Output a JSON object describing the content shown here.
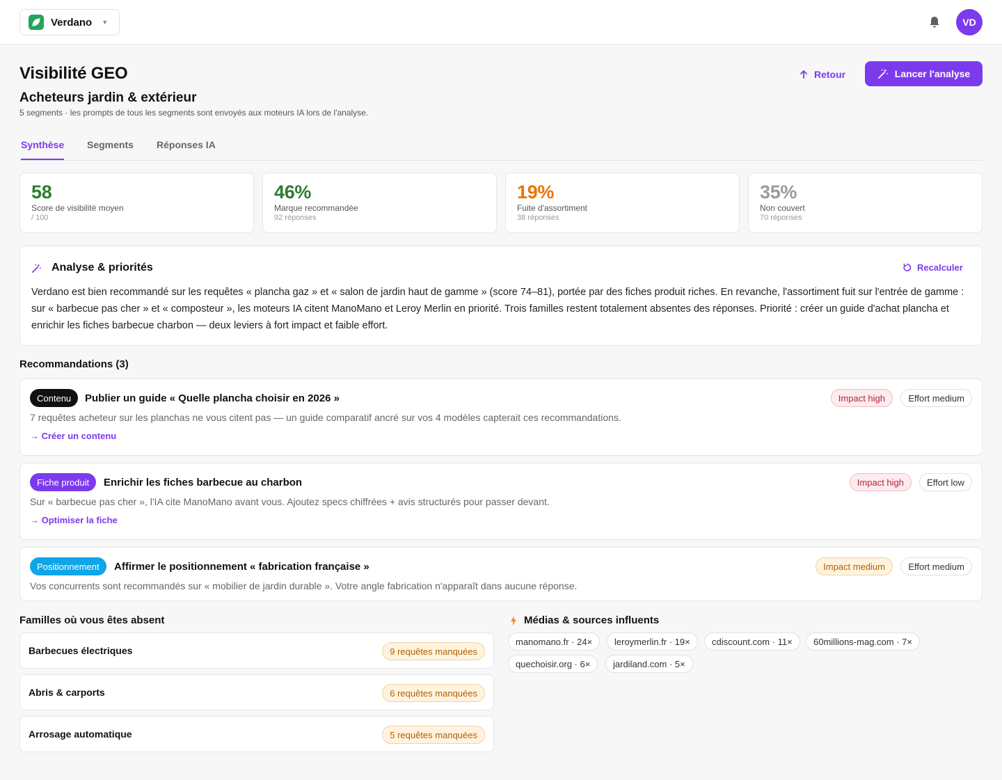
{
  "workspace": {
    "name": "Verdano"
  },
  "user": {
    "initials": "VD"
  },
  "header": {
    "title": "Visibilité GEO",
    "back_label": "Retour",
    "launch_label": "Lancer l'analyse",
    "subtitle": "Acheteurs jardin & extérieur",
    "note": "5 segments · les prompts de tous les segments sont envoyés aux moteurs IA lors de l'analyse."
  },
  "tabs": [
    {
      "label": "Synthèse",
      "active": true
    },
    {
      "label": "Segments",
      "active": false
    },
    {
      "label": "Réponses IA",
      "active": false
    }
  ],
  "kpis": [
    {
      "value": "58",
      "label": "Score de visibilité moyen",
      "sub": "/ 100",
      "color": "#2e7d32"
    },
    {
      "value": "46%",
      "label": "Marque recommandée",
      "sub": "92 réponses",
      "color": "#2e7d32"
    },
    {
      "value": "19%",
      "label": "Fuite d'assortiment",
      "sub": "38 réponses",
      "color": "#e8750a"
    },
    {
      "value": "35%",
      "label": "Non couvert",
      "sub": "70 réponses",
      "color": "#9a9a9f"
    }
  ],
  "analysis": {
    "title": "Analyse & priorités",
    "recalc_label": "Recalculer",
    "text": "Verdano est bien recommandé sur les requêtes « plancha gaz » et « salon de jardin haut de gamme » (score 74–81), portée par des fiches produit riches. En revanche, l'assortiment fuit sur l'entrée de gamme : sur « barbecue pas cher » et « composteur », les moteurs IA citent ManoMano et Leroy Merlin en priorité. Trois familles restent totalement absentes des réponses. Priorité : créer un guide d'achat plancha et enrichir les fiches barbecue charbon — deux leviers à fort impact et faible effort."
  },
  "recommendations": {
    "title": "Recommandations (3)",
    "items": [
      {
        "tag": "Contenu",
        "tag_color": "#111111",
        "title": "Publier un guide « Quelle plancha choisir en 2026 »",
        "desc": "7 requêtes acheteur sur les planchas ne vous citent pas — un guide comparatif ancré sur vos 4 modèles capterait ces recommandations.",
        "link": "→ Créer un contenu",
        "impact": "Impact high",
        "effort": "Effort medium"
      },
      {
        "tag": "Fiche produit",
        "tag_color": "#7c3aed",
        "title": "Enrichir les fiches barbecue au charbon",
        "desc": "Sur « barbecue pas cher », l'IA cite ManoMano avant vous. Ajoutez specs chiffrées + avis structurés pour passer devant.",
        "link": "→ Optimiser la fiche",
        "impact": "Impact high",
        "effort": "Effort low"
      },
      {
        "tag": "Positionnement",
        "tag_color": "#0ea5e9",
        "title": "Affirmer le positionnement « fabrication française »",
        "desc": "Vos concurrents sont recommandés sur « mobilier de jardin durable ». Votre angle fabrication n'apparaît dans aucune réponse.",
        "impact": "Impact medium",
        "effort": "Effort medium"
      }
    ]
  },
  "families": {
    "title": "Familles où vous êtes absent",
    "items": [
      {
        "name": "Barbecues électriques",
        "badge": "9 requêtes manquées"
      },
      {
        "name": "Abris & carports",
        "badge": "6 requêtes manquées"
      },
      {
        "name": "Arrosage automatique",
        "badge": "5 requêtes manquées"
      }
    ]
  },
  "media": {
    "title": "Médias & sources influents",
    "sources": [
      "manomano.fr · 24×",
      "leroymerlin.fr · 19×",
      "cdiscount.com · 11×",
      "60millions-mag.com · 7×",
      "quechoisir.org · 6×",
      "jardiland.com · 5×"
    ]
  }
}
